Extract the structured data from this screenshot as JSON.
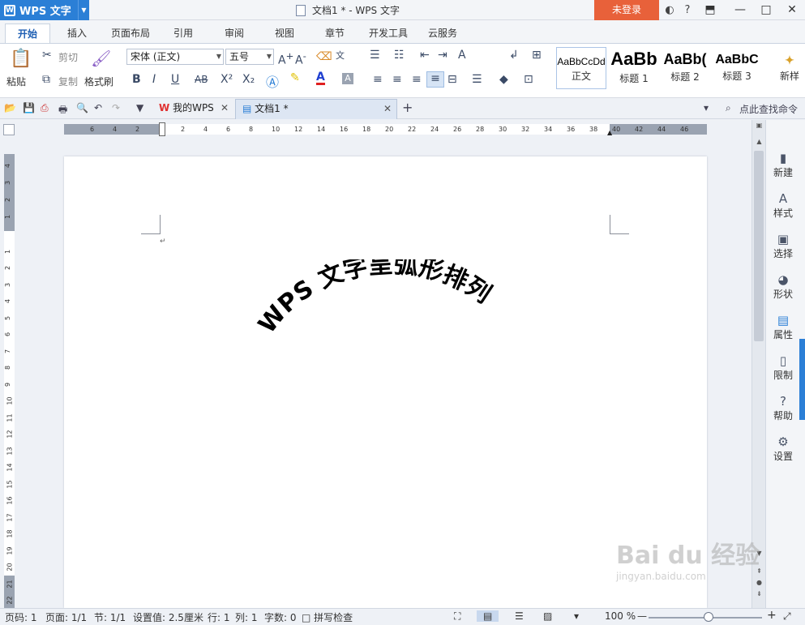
{
  "titlebar": {
    "app_name": "WPS 文字",
    "doc_title": "文档1 * - WPS 文字",
    "login": "未登录",
    "help": "?",
    "controls": [
      "—",
      "□",
      "✕"
    ]
  },
  "menu_tabs": [
    {
      "label": "开始",
      "active": true
    },
    {
      "label": "插入"
    },
    {
      "label": "页面布局"
    },
    {
      "label": "引用"
    },
    {
      "label": "审阅"
    },
    {
      "label": "视图"
    },
    {
      "label": "章节"
    },
    {
      "label": "开发工具"
    },
    {
      "label": "云服务"
    }
  ],
  "ribbon": {
    "paste": "粘贴",
    "cut": "剪切",
    "copy": "复制",
    "format_painter": "格式刷",
    "font_name": "宋体 (正文)",
    "font_size": "五号",
    "bold": "B",
    "italic": "I",
    "underline": "U",
    "strike": "AB",
    "superscript": "X²",
    "subscript": "X₂",
    "font_color": "A",
    "styles": [
      {
        "sample": "AaBbCcDd",
        "name": "正文"
      },
      {
        "sample": "AaBb",
        "name": "标题 1"
      },
      {
        "sample": "AaBb(",
        "name": "标题 2"
      },
      {
        "sample": "AaBbC",
        "name": "标题 3"
      },
      {
        "sample": "",
        "name": "新样"
      }
    ]
  },
  "quickbar": {
    "tabs": [
      {
        "label": "我的WPS"
      },
      {
        "label": "文档1 *",
        "active": true
      }
    ],
    "add_tab": "+",
    "find_command": "点此查找命令"
  },
  "ruler": {
    "h_numbers": [
      "6",
      "4",
      "2",
      "2",
      "4",
      "6",
      "8",
      "10",
      "12",
      "14",
      "16",
      "18",
      "20",
      "22",
      "24",
      "26",
      "28",
      "30",
      "32",
      "34",
      "36",
      "38",
      "40",
      "42",
      "44",
      "46"
    ],
    "v_numbers": [
      "4",
      "3",
      "2",
      "1",
      "1",
      "2",
      "3",
      "4",
      "5",
      "6",
      "7",
      "8",
      "9",
      "10",
      "11",
      "12",
      "13",
      "14",
      "15",
      "16",
      "17",
      "18",
      "19",
      "20",
      "21",
      "22"
    ]
  },
  "document": {
    "arc_text": "WPS 文字呈弧形排列",
    "paragraph_mark": "↵"
  },
  "taskpane": [
    {
      "label": "新建",
      "icon": "new-doc-icon"
    },
    {
      "label": "样式",
      "icon": "style-icon"
    },
    {
      "label": "选择",
      "icon": "select-icon"
    },
    {
      "label": "形状",
      "icon": "shape-icon"
    },
    {
      "label": "属性",
      "icon": "property-icon"
    },
    {
      "label": "限制",
      "icon": "restrict-icon"
    },
    {
      "label": "帮助",
      "icon": "help-icon"
    },
    {
      "label": "设置",
      "icon": "gear-icon"
    }
  ],
  "statusbar": {
    "page_code": "页码: 1",
    "page": "页面: 1/1",
    "section": "节: 1/1",
    "setting": "设置值: 2.5厘米",
    "row": "行: 1",
    "col": "列: 1",
    "words": "字数: 0",
    "spell": "拼写检查",
    "zoom": "100 %",
    "zoom_minus": "—",
    "zoom_plus": "+"
  },
  "watermark": {
    "main": "Bai du 经验",
    "sub": "jingyan.baidu.com"
  },
  "colors": {
    "brand": "#2b7fd6",
    "login": "#e8613a"
  }
}
